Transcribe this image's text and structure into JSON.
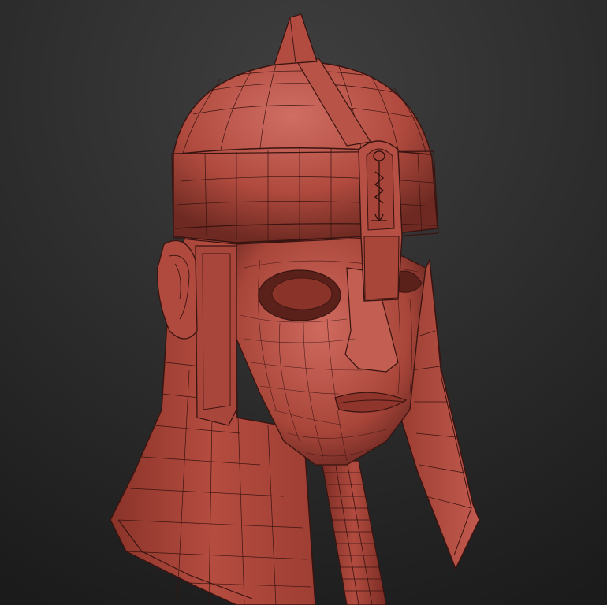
{
  "viewport": {
    "background_top": "#3a3a3a",
    "background_bottom": "#1a1a1a",
    "render_mode": "wireframe-on-shaded"
  },
  "model": {
    "subject": "helmet-with-face",
    "base_color": "#b54a3e",
    "highlight_color": "#d0706a",
    "shadow_color": "#6a2520",
    "wire_color": "#3a1410"
  }
}
